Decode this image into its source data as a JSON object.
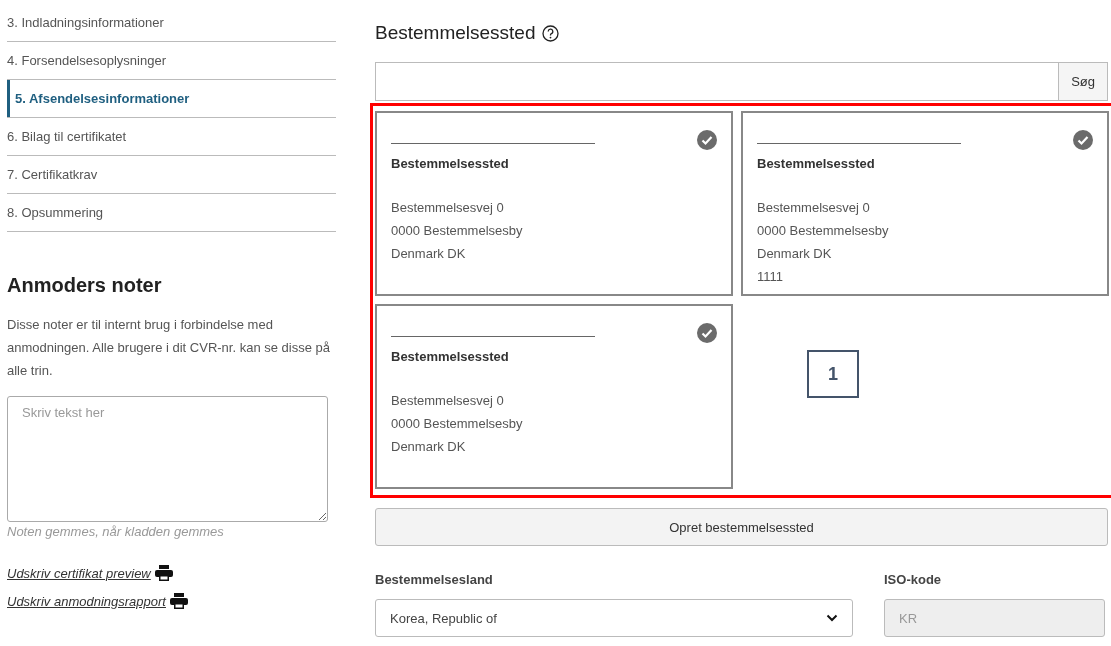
{
  "steps": [
    {
      "label": "3. Indladningsinformationer",
      "selected": false
    },
    {
      "label": "4. Forsendelsesoplysninger",
      "selected": false
    },
    {
      "label": "5. Afsendelsesinformationer",
      "selected": true
    },
    {
      "label": "6. Bilag til certifikatet",
      "selected": false
    },
    {
      "label": "7. Certifikatkrav",
      "selected": false
    },
    {
      "label": "8. Opsummering",
      "selected": false
    }
  ],
  "notes": {
    "title": "Anmoders noter",
    "description": "Disse noter er til internt brug i forbindelse med anmodningen. Alle brugere i dit CVR-nr. kan se disse på alle trin.",
    "placeholder": "Skriv tekst her",
    "hint": "Noten gemmes, når kladden gemmes"
  },
  "print_links": [
    "Udskriv certifikat preview",
    "Udskriv anmodningsrapport"
  ],
  "destination": {
    "title": "Bestemmelsessted",
    "search_button": "Søg",
    "cards": [
      {
        "title": "Bestemmelsessted",
        "lines": [
          "Bestemmelsesvej 0",
          "0000 Bestemmelsesby",
          "Denmark DK"
        ],
        "selected": true
      },
      {
        "title": "Bestemmelsessted",
        "lines": [
          "Bestemmelsesvej 0",
          "0000 Bestemmelsesby",
          "Denmark DK",
          "1111"
        ],
        "selected": true
      },
      {
        "title": "Bestemmelsessted",
        "lines": [
          "Bestemmelsesvej 0",
          "0000 Bestemmelsesby",
          "Denmark DK"
        ],
        "selected": true
      }
    ],
    "annotation": "1",
    "create_button": "Opret bestemmelsessted",
    "country_label": "Bestemmelsesland",
    "country_value": "Korea, Republic of",
    "iso_label": "ISO-kode",
    "iso_value": "KR"
  }
}
